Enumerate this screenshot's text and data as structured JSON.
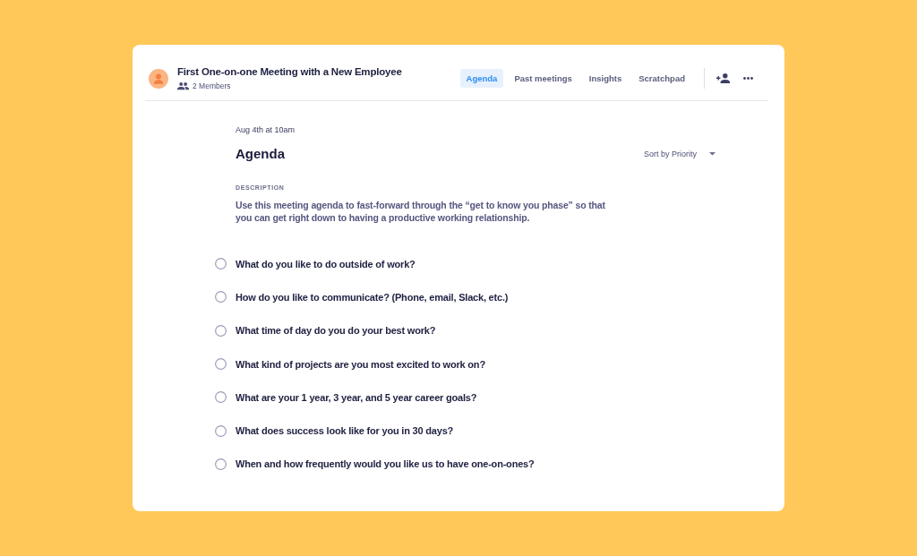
{
  "meeting": {
    "title": "First One-on-one Meeting with a New Employee",
    "members": "2 Members"
  },
  "tabs": [
    {
      "label": "Agenda",
      "selected": true
    },
    {
      "label": "Past meetings",
      "selected": false
    },
    {
      "label": "Insights",
      "selected": false
    },
    {
      "label": "Scratchpad",
      "selected": false
    }
  ],
  "agenda": {
    "date": "Aug 4th at 10am",
    "heading": "Agenda",
    "sort": "Sort by Priority",
    "description_label": "DESCRIPTION",
    "description": "Use this meeting agenda to fast-forward through the “get to know you phase” so that you can get right down to having a productive working relationship."
  },
  "items": [
    {
      "text": "What do you like to do outside of work?",
      "checked": false
    },
    {
      "text": "How do you like to communicate? (Phone, email, Slack, etc.)",
      "checked": false
    },
    {
      "text": "What time of day do you do your best work?",
      "checked": false
    },
    {
      "text": "What kind of projects are you most excited to work on?",
      "checked": false
    },
    {
      "text": "What are your 1 year, 3 year, and 5 year career goals?",
      "checked": false
    },
    {
      "text": "What does success look like for you in 30 days?",
      "checked": false
    },
    {
      "text": "When and how frequently would you like us to have one-on-ones?",
      "checked": false
    }
  ]
}
